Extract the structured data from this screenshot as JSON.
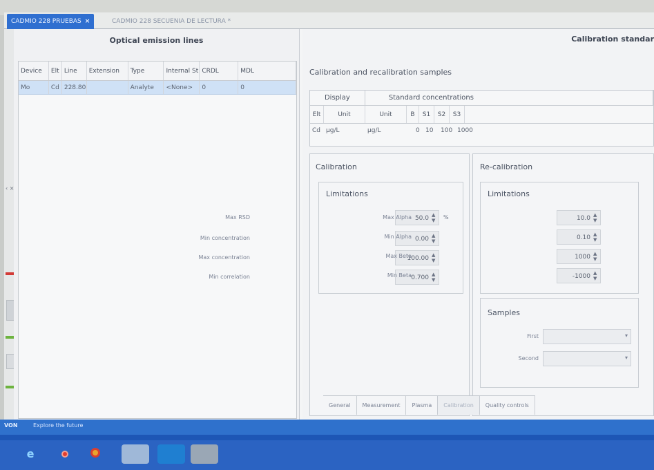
{
  "tabs": {
    "active_label": "CADMIO 228 PRUEBAS",
    "active_close": "×",
    "inactive_label": "CADMIO 228 SECUENIA DE LECTURA *"
  },
  "optical": {
    "title": "Optical emission lines",
    "columns": [
      "Device",
      "Elt",
      "Line",
      "Extension",
      "Type",
      "Internal Sti",
      "CRDL",
      "MDL"
    ],
    "row": [
      "Mo",
      "Cd",
      "228.80",
      "",
      "Analyte",
      "<None>",
      "0",
      "0"
    ]
  },
  "right": {
    "header_title": "Calibration standar",
    "section_title": "Calibration and recalibration samples",
    "display_label": "Display",
    "std_conc_label": "Standard concentrations",
    "sub_headers": [
      "Elt",
      "Unit",
      "Unit",
      "B",
      "S1",
      "S2",
      "S3"
    ],
    "values": [
      "Cd",
      "µg/L",
      "µg/L",
      "0",
      "10",
      "100",
      "1000"
    ]
  },
  "calibration": {
    "title": "Calibration",
    "limitations": "Limitations",
    "fields": [
      {
        "label": "Max RSD",
        "value": "50.0",
        "unit": "%"
      },
      {
        "label": "Min concentration",
        "value": "0.00",
        "unit": ""
      },
      {
        "label": "Max concentration",
        "value": "100.00",
        "unit": ""
      },
      {
        "label": "Min correlation",
        "value": "0.700",
        "unit": ""
      }
    ]
  },
  "recalibration": {
    "title": "Re-calibration",
    "limitations": "Limitations",
    "fields": [
      {
        "label": "Max Alpha",
        "value": "10.0"
      },
      {
        "label": "Min Alpha",
        "value": "0.10"
      },
      {
        "label": "Max Beta",
        "value": "1000"
      },
      {
        "label": "Min Beta",
        "value": "-1000"
      }
    ],
    "samples_title": "Samples",
    "first_label": "First",
    "second_label": "Second"
  },
  "bottom_tabs": [
    "General",
    "Measurement",
    "Plasma",
    "Calibration",
    "Quality controls"
  ],
  "status": {
    "left": "VON",
    "text": "Explore the future"
  }
}
